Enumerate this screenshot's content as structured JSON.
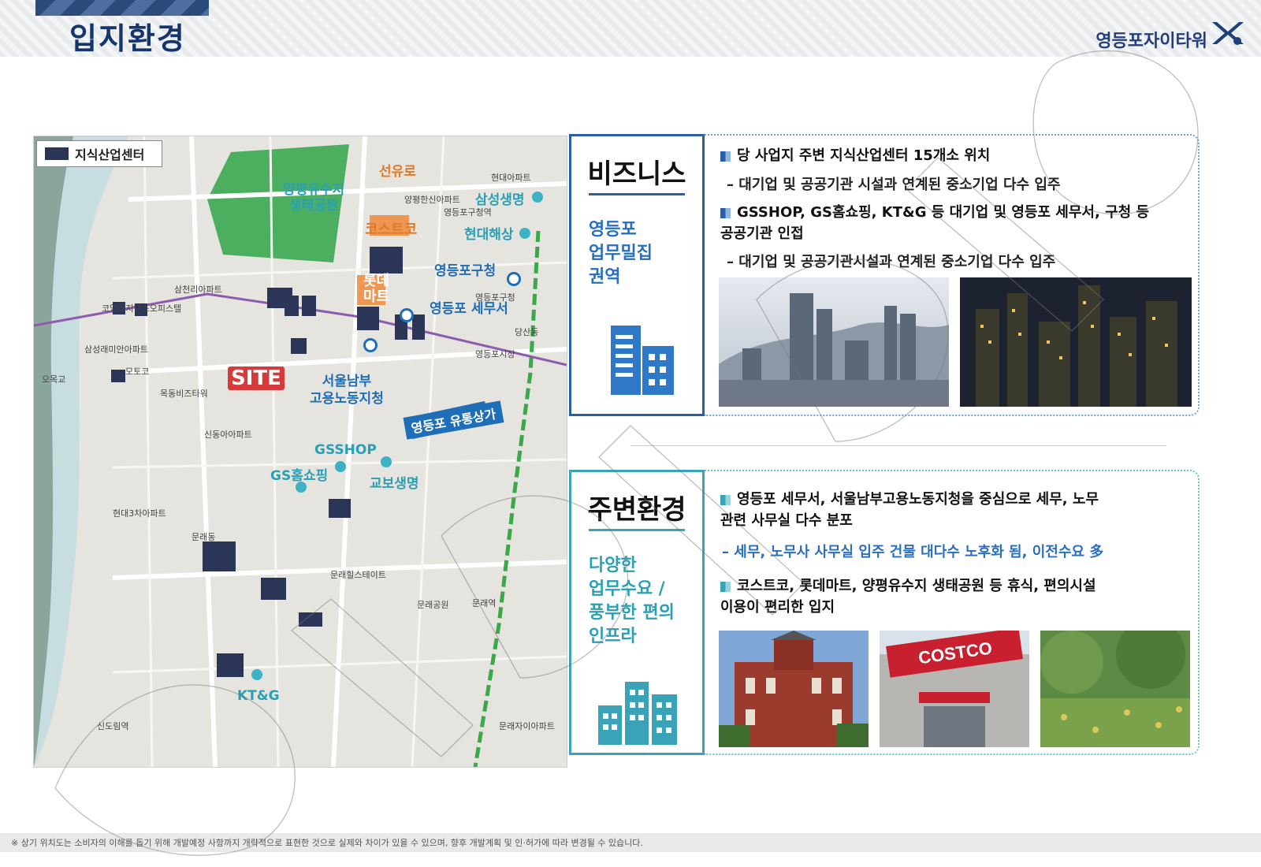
{
  "header": {
    "title": "입지환경",
    "brand": "영등포자이타워"
  },
  "map": {
    "legend": "지식산업센터",
    "site_label": "SITE",
    "pois": {
      "yangpyeong_park": "양평유수지\n생태공원",
      "seonyuro": "선유로",
      "samsung_life": "삼성생명",
      "costco": "코스트코",
      "hyundai_haesang": "현대해상",
      "yeongdeungpo_gu_office": "영등포구청",
      "lotte_mart": "롯데\n마트",
      "tax_office": "영등포 세무서",
      "labor_office": "서울남부\n고용노동지청",
      "yutong_sangga": "영등포 유통상가",
      "gsshop": "GSSHOP",
      "gs_homeshopping": "GS홈쇼핑",
      "kyobo_life": "교보생명",
      "ktg": "KT&G"
    },
    "small_labels": [
      "현대아파트",
      "양평한신아파트",
      "영등포구청역",
      "삼천리아파트",
      "코업레지던스오피스텔",
      "삼성래미안아파트",
      "문래자이아파트",
      "모토코",
      "영등포구청",
      "영등포시장",
      "당산동",
      "오목교",
      "목동비즈타워",
      "신동아아파트",
      "문래힐스테이트",
      "문래동",
      "현대3차아파트",
      "문래공원",
      "신도림역",
      "문래역"
    ]
  },
  "business": {
    "title": "비즈니스",
    "subtitle": "영등포\n업무밀집\n권역",
    "bullets": [
      "당 사업지 주변 지식산업센터 15개소 위치",
      "GSSHOP, GS홈쇼핑, KT&G 등 대기업 및 영등포 세무서, 구청 등\n공공기관 인접"
    ],
    "sublines": [
      "– 대기업 및 공공기관 시설과 연계된 중소기업 다수 입주",
      "– 대기업 및 공공기관시설과 연계된 중소기업 다수 입주"
    ]
  },
  "surroundings": {
    "title": "주변환경",
    "subtitle": "다양한\n업무수요 /\n풍부한 편의\n인프라",
    "bullets": [
      "영등포 세무서, 서울남부고용노동지청을 중심으로 세무, 노무\n관련 사무실 다수 분포",
      "코스트코, 롯데마트, 양평유수지 생태공원 등 휴식, 편의시설\n이용이 편리한 입지"
    ],
    "sublines": [
      "– 세무, 노무사 사무실 입주 건물 대다수 노후화 됨, 이전수요 多"
    ],
    "photo_costco_sign": "COSTCO"
  },
  "footer": {
    "note": "※ 상기 위치도는 소비자의 이해를 돕기 위해 개발예정 사항까지 개략적으로 표현한 것으로 실제와 차이가 있을 수 있으며, 향후 개발계획 및 인·허가에 따라 변경될 수 있습니다."
  },
  "colors": {
    "title": "#14366b",
    "business": "#2a5fa8",
    "surroundings": "#3aa3b8",
    "site": "#d63a3a",
    "building": "#2a3557"
  }
}
